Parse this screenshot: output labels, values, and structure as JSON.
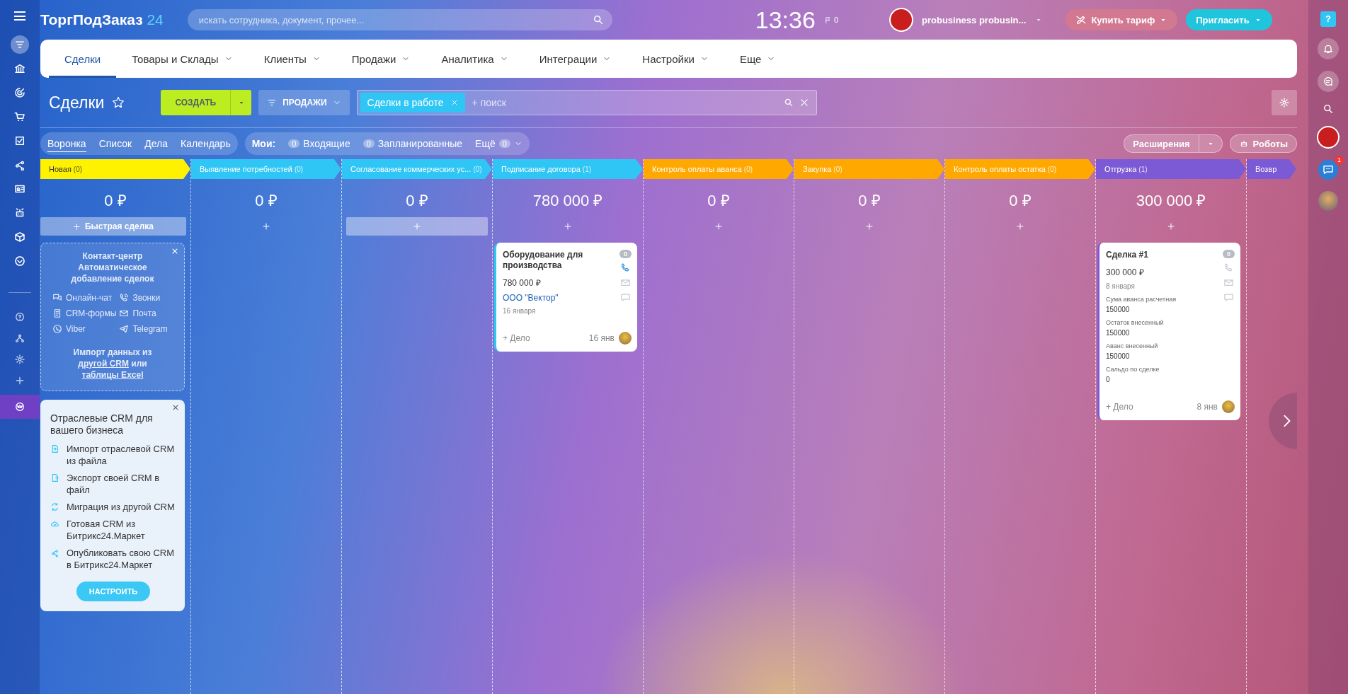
{
  "header": {
    "logo": "ТоргПодЗаказ",
    "logo_suffix": "24",
    "search": {
      "placeholder": "искать сотрудника, документ, прочее..."
    },
    "time": "13:36",
    "flag_count": "0",
    "user": "probusiness probusin...",
    "buy_button": "Купить тариф",
    "invite_button": "Пригласить"
  },
  "left_sidebar": {
    "items": [
      {
        "kind": "filter",
        "selected": true
      },
      {
        "kind": "bank",
        "selected": false
      },
      {
        "kind": "target",
        "selected": false
      },
      {
        "kind": "cart",
        "selected": false
      },
      {
        "kind": "task",
        "selected": false
      },
      {
        "kind": "share",
        "selected": false
      },
      {
        "kind": "contact",
        "selected": false
      },
      {
        "kind": "robot",
        "selected": false
      },
      {
        "kind": "box",
        "selected": false
      },
      {
        "kind": "more",
        "selected": false
      }
    ],
    "bottom_items": [
      {
        "kind": "help",
        "selected": false
      },
      {
        "kind": "structure",
        "selected": false
      },
      {
        "kind": "gear",
        "selected": false
      },
      {
        "kind": "plus",
        "selected": false
      },
      {
        "kind": "crown",
        "selected": true
      }
    ]
  },
  "nav_tabs": [
    {
      "label": "Сделки",
      "selected": true,
      "dropdown": false
    },
    {
      "label": "Товары и Склады",
      "selected": false,
      "dropdown": true
    },
    {
      "label": "Клиенты",
      "selected": false,
      "dropdown": true
    },
    {
      "label": "Продажи",
      "selected": false,
      "dropdown": true
    },
    {
      "label": "Аналитика",
      "selected": false,
      "dropdown": true
    },
    {
      "label": "Интеграции",
      "selected": false,
      "dropdown": true
    },
    {
      "label": "Настройки",
      "selected": false,
      "dropdown": true
    },
    {
      "label": "Еще",
      "selected": false,
      "dropdown": true
    }
  ],
  "toolbar": {
    "title": "Сделки",
    "create_button": "СОЗДАТЬ",
    "category_button": "ПРОДАЖИ",
    "filter_tag": "Сделки в работе",
    "search": {
      "placeholder": "+ поиск"
    }
  },
  "view_tabs": [
    {
      "label": "Воронка",
      "selected": true
    },
    {
      "label": "Список",
      "selected": false
    },
    {
      "label": "Дела",
      "selected": false
    },
    {
      "label": "Календарь",
      "selected": false
    }
  ],
  "counters": {
    "label": "Мои:",
    "items": [
      {
        "count": "0",
        "label": "Входящие"
      },
      {
        "count": "0",
        "label": "Запланированные"
      }
    ],
    "more": {
      "label": "Ещё",
      "count": "0"
    }
  },
  "extensions_button": "Расширения",
  "robots_button": "Роботы",
  "columns": [
    {
      "title": "Новая",
      "count": "(0)",
      "color": "#fff200",
      "sum": "0 ₽",
      "add_control": {
        "kind": "quick",
        "label": "Быстрая сделка"
      }
    },
    {
      "title": "Выявление потребностей",
      "count": "(0)",
      "color": "#2fc6f6",
      "sum": "0 ₽",
      "add_control": {
        "kind": "plus"
      }
    },
    {
      "title": "Согласование коммерческих ус...",
      "count": "(0)",
      "color": "#2fc6f6",
      "sum": "0 ₽",
      "add_control": {
        "kind": "bar"
      }
    },
    {
      "title": "Подписание договора",
      "count": "(1)",
      "color": "#2fc6f6",
      "sum": "780 000 ₽",
      "add_control": {
        "kind": "plus"
      },
      "cards": [
        {
          "title": "Оборудование для производства",
          "sum": "780 000 ₽",
          "company": "ООО \"Вектор\"",
          "date": "16 января",
          "counter": "0",
          "phone_active": true,
          "action": "+ Дело",
          "footer_date": "16 янв"
        }
      ]
    },
    {
      "title": "Контроль оплаты аванса",
      "count": "(0)",
      "color": "#ffa900",
      "sum": "0 ₽",
      "add_control": {
        "kind": "plus"
      }
    },
    {
      "title": "Закупка",
      "count": "(0)",
      "color": "#ffa900",
      "sum": "0 ₽",
      "add_control": {
        "kind": "plus"
      }
    },
    {
      "title": "Контроль оплаты остатка",
      "count": "(0)",
      "color": "#ffa900",
      "sum": "0 ₽",
      "add_control": {
        "kind": "plus"
      }
    },
    {
      "title": "Отгрузка",
      "count": "(1)",
      "color": "#7c5ad6",
      "sum": "300 000 ₽",
      "add_control": {
        "kind": "plus"
      },
      "cards": [
        {
          "title": "Сделка #1",
          "sum": "300 000 ₽",
          "date": "8 января",
          "fields": [
            {
              "label": "Сума аванса расчетная",
              "value": "150000"
            },
            {
              "label": "Остаток внесенный",
              "value": "150000"
            },
            {
              "label": "Аванс внесенный",
              "value": "150000"
            },
            {
              "label": "Сальдо по сделке",
              "value": "0"
            }
          ],
          "counter": "0",
          "phone_active": false,
          "action": "+ Дело",
          "footer_date": "8 янв"
        }
      ]
    },
    {
      "title": "Возвр",
      "color": "#7c5ad6"
    }
  ],
  "contact_center": {
    "title": "Контакт-центр Автоматическое добавление сделок",
    "channels": [
      {
        "kind": "chat",
        "label": "Онлайн-чат"
      },
      {
        "kind": "call",
        "label": "Звонки"
      },
      {
        "kind": "form",
        "label": "CRM-формы"
      },
      {
        "kind": "mail",
        "label": "Почта"
      },
      {
        "kind": "viber",
        "label": "Viber"
      },
      {
        "kind": "telegram",
        "label": "Telegram"
      }
    ],
    "import_text": "Импорт данных из ",
    "import_link": "другой CRM",
    "import_or": " или ",
    "import_link2": "таблицы Excel"
  },
  "industry_crm": {
    "title": "Отраслевые CRM для вашего бизнеса",
    "items": [
      {
        "kind": "import",
        "label": "Импорт отраслевой CRM из файла"
      },
      {
        "kind": "export",
        "label": "Экспорт своей CRM в файл"
      },
      {
        "kind": "migrate",
        "label": "Миграция из другой CRM"
      },
      {
        "kind": "cloud",
        "label": "Готовая CRM из Битрикс24.Маркет"
      },
      {
        "kind": "share",
        "label": "Опубликовать свою CRM в Битрикс24.Маркет"
      }
    ],
    "button": "НАСТРОИТЬ"
  },
  "right_sidebar": {
    "help": "?",
    "chat_badge": "1"
  }
}
